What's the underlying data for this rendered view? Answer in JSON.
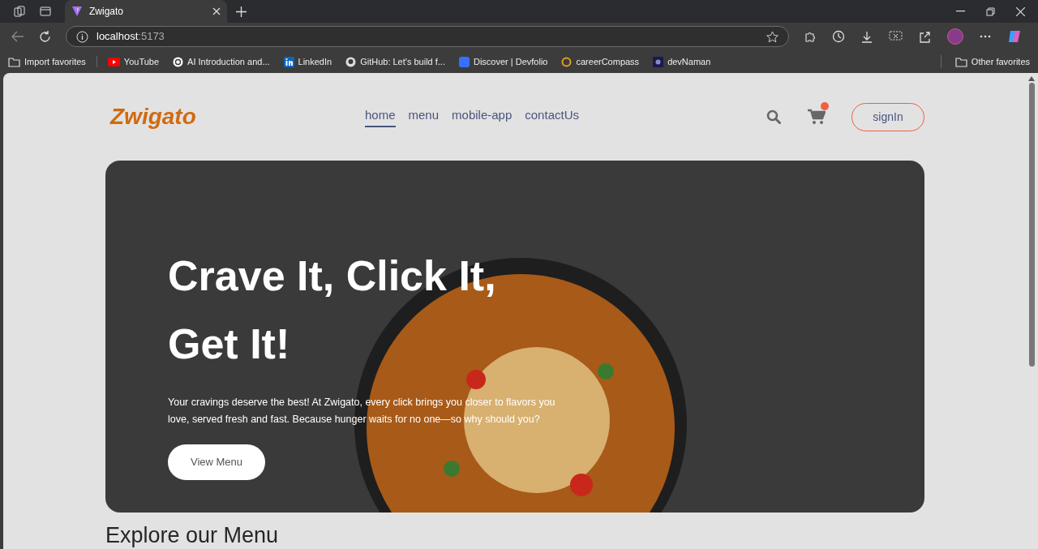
{
  "browser": {
    "tab_title": "Zwigato",
    "url_host": "localhost",
    "url_port": ":5173",
    "bookmarks": [
      {
        "label": "Import favorites",
        "kind": "import"
      },
      {
        "label": "YouTube",
        "kind": "youtube"
      },
      {
        "label": "AI Introduction and...",
        "kind": "ai"
      },
      {
        "label": "LinkedIn",
        "kind": "linkedin"
      },
      {
        "label": "GitHub: Let's build f...",
        "kind": "github"
      },
      {
        "label": "Discover | Devfolio",
        "kind": "devfolio"
      },
      {
        "label": "careerCompass",
        "kind": "compass"
      },
      {
        "label": "devNaman",
        "kind": "dev"
      }
    ],
    "other_favorites": "Other favorites"
  },
  "navbar": {
    "logo": "Zwigato",
    "links": [
      {
        "label": "home",
        "selected": true
      },
      {
        "label": "menu",
        "selected": false
      },
      {
        "label": "mobile-app",
        "selected": false
      },
      {
        "label": "contactUs",
        "selected": false
      }
    ],
    "cart_has_items": true,
    "signin": "signIn"
  },
  "hero": {
    "heading_lines": [
      "Crave It, Click It,",
      "Get It!"
    ],
    "text": "Your cravings deserve the best! At Zwigato, every click brings you closer to flavors you love, served fresh and fast. Because hunger waits for no one—so why should you?",
    "button": "View Menu"
  },
  "section_title": "Explore our Menu"
}
